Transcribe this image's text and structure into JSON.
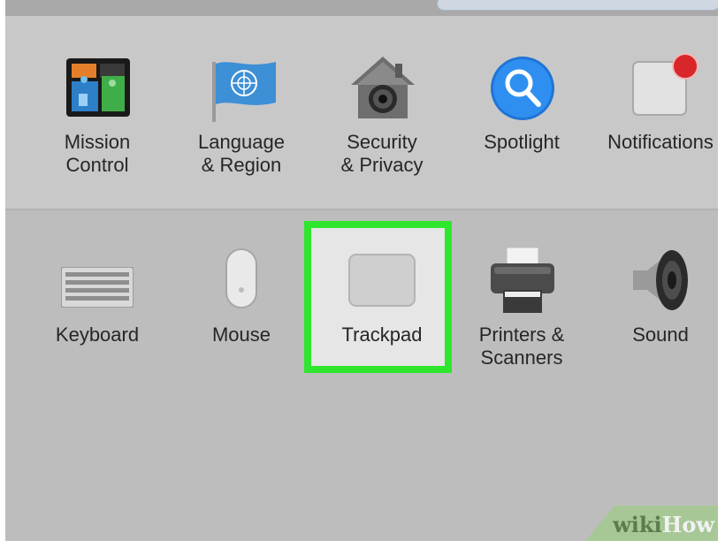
{
  "preferences": {
    "row1": [
      {
        "label": "Mission\nControl",
        "icon": "mission-control-icon"
      },
      {
        "label": "Language\n& Region",
        "icon": "un-flag-icon"
      },
      {
        "label": "Security\n& Privacy",
        "icon": "security-house-icon"
      },
      {
        "label": "Spotlight",
        "icon": "magnifier-icon"
      },
      {
        "label": "Notifications",
        "icon": "notifications-icon"
      }
    ],
    "row2": [
      {
        "label": "Keyboard",
        "icon": "keyboard-icon"
      },
      {
        "label": "Mouse",
        "icon": "mouse-icon"
      },
      {
        "label": "Trackpad",
        "icon": "trackpad-icon"
      },
      {
        "label": "Printers &\nScanners",
        "icon": "printer-icon"
      },
      {
        "label": "Sound",
        "icon": "speaker-icon"
      }
    ]
  },
  "highlight_color": "#2ee62e",
  "watermark": {
    "part1": "wiki",
    "part2": "How"
  }
}
